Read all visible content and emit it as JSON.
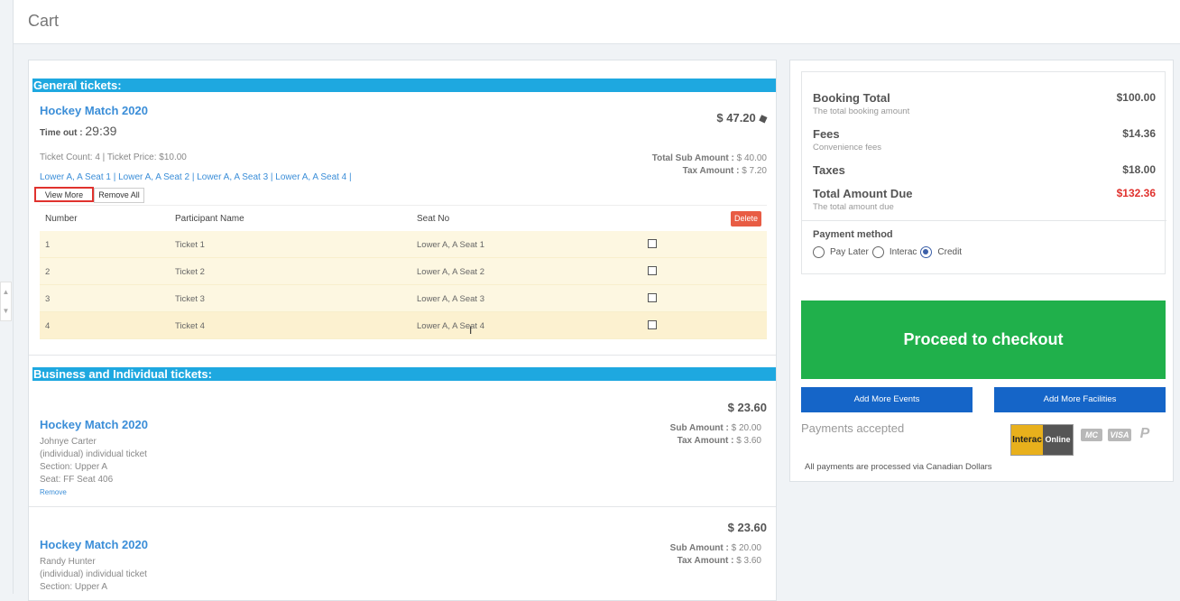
{
  "header": {
    "title": "Cart"
  },
  "general": {
    "section_title": "General tickets:",
    "event_title": "Hockey Match 2020",
    "timeout_label": "Time out :",
    "timeout_value": "29:39",
    "price": "$ 47.20",
    "ticket_info": "Ticket Count: 4 | Ticket Price: $10.00",
    "total_sub": "Total Sub Amount :",
    "total_sub_value": "$ 40.00",
    "tax": "Tax Amount :",
    "tax_value": "$ 7.20",
    "seats_line": "Lower A, A Seat 1 | Lower A, A Seat 2 | Lower A, A Seat 3 | Lower A, A Seat 4 |",
    "view_more": "View More",
    "remove_all": "Remove All",
    "table": {
      "headers": [
        "Number",
        "Participant Name",
        "Seat No"
      ],
      "delete_label": "Delete",
      "rows": [
        {
          "number": "1",
          "name": "Ticket 1",
          "seat": "Lower A, A Seat 1"
        },
        {
          "number": "2",
          "name": "Ticket 2",
          "seat": "Lower A, A Seat 2"
        },
        {
          "number": "3",
          "name": "Ticket 3",
          "seat": "Lower A, A Seat 3"
        },
        {
          "number": "4",
          "name": "Ticket 4",
          "seat": "Lower A, A Seat 4"
        }
      ]
    }
  },
  "business": {
    "section_title": "Business and Individual tickets:",
    "items": [
      {
        "title": "Hockey Match 2020",
        "price": "$ 23.60",
        "sub_label": "Sub Amount :",
        "sub_value": "$ 20.00",
        "tax_label": "Tax Amount :",
        "tax_value": "$ 3.60",
        "name": "Johnye Carter",
        "type": "(individual) individual ticket",
        "section": "Section: Upper A",
        "seat": "Seat: FF Seat 406",
        "remove": "Remove"
      },
      {
        "title": "Hockey Match 2020",
        "price": "$ 23.60",
        "sub_label": "Sub Amount :",
        "sub_value": "$ 20.00",
        "tax_label": "Tax Amount :",
        "tax_value": "$ 3.60",
        "name": "Randy Hunter",
        "type": "(individual) individual ticket",
        "section": "Section: Upper A"
      }
    ]
  },
  "summary": {
    "booking_total_label": "Booking Total",
    "booking_total_sub": "The total booking amount",
    "booking_total_value": "$100.00",
    "fees_label": "Fees",
    "fees_sub": "Convenience fees",
    "fees_value": "$14.36",
    "taxes_label": "Taxes",
    "taxes_value": "$18.00",
    "due_label": "Total Amount Due",
    "due_sub": "The total amount due",
    "due_value": "$132.36",
    "due_color": "#e0322e",
    "payment_method_label": "Payment method",
    "payment_options": [
      "Pay Later",
      "Interac",
      "Credit"
    ],
    "selected_payment": "Credit"
  },
  "actions": {
    "checkout": "Proceed to checkout",
    "add_events": "Add More Events",
    "add_facilities": "Add More Facilities",
    "payments_accepted": "Payments accepted",
    "interac_left": "Interac",
    "interac_right": "Online",
    "mastercard": "MC",
    "visa": "VISA",
    "paypal": "P",
    "note": "All payments are processed via Canadian Dollars"
  },
  "colors": {
    "section_bar": "#1ea8e0",
    "link": "#3b8ed8",
    "checkout_green": "#20b04b",
    "button_blue": "#1565c8",
    "delete_red": "#e85c44"
  }
}
